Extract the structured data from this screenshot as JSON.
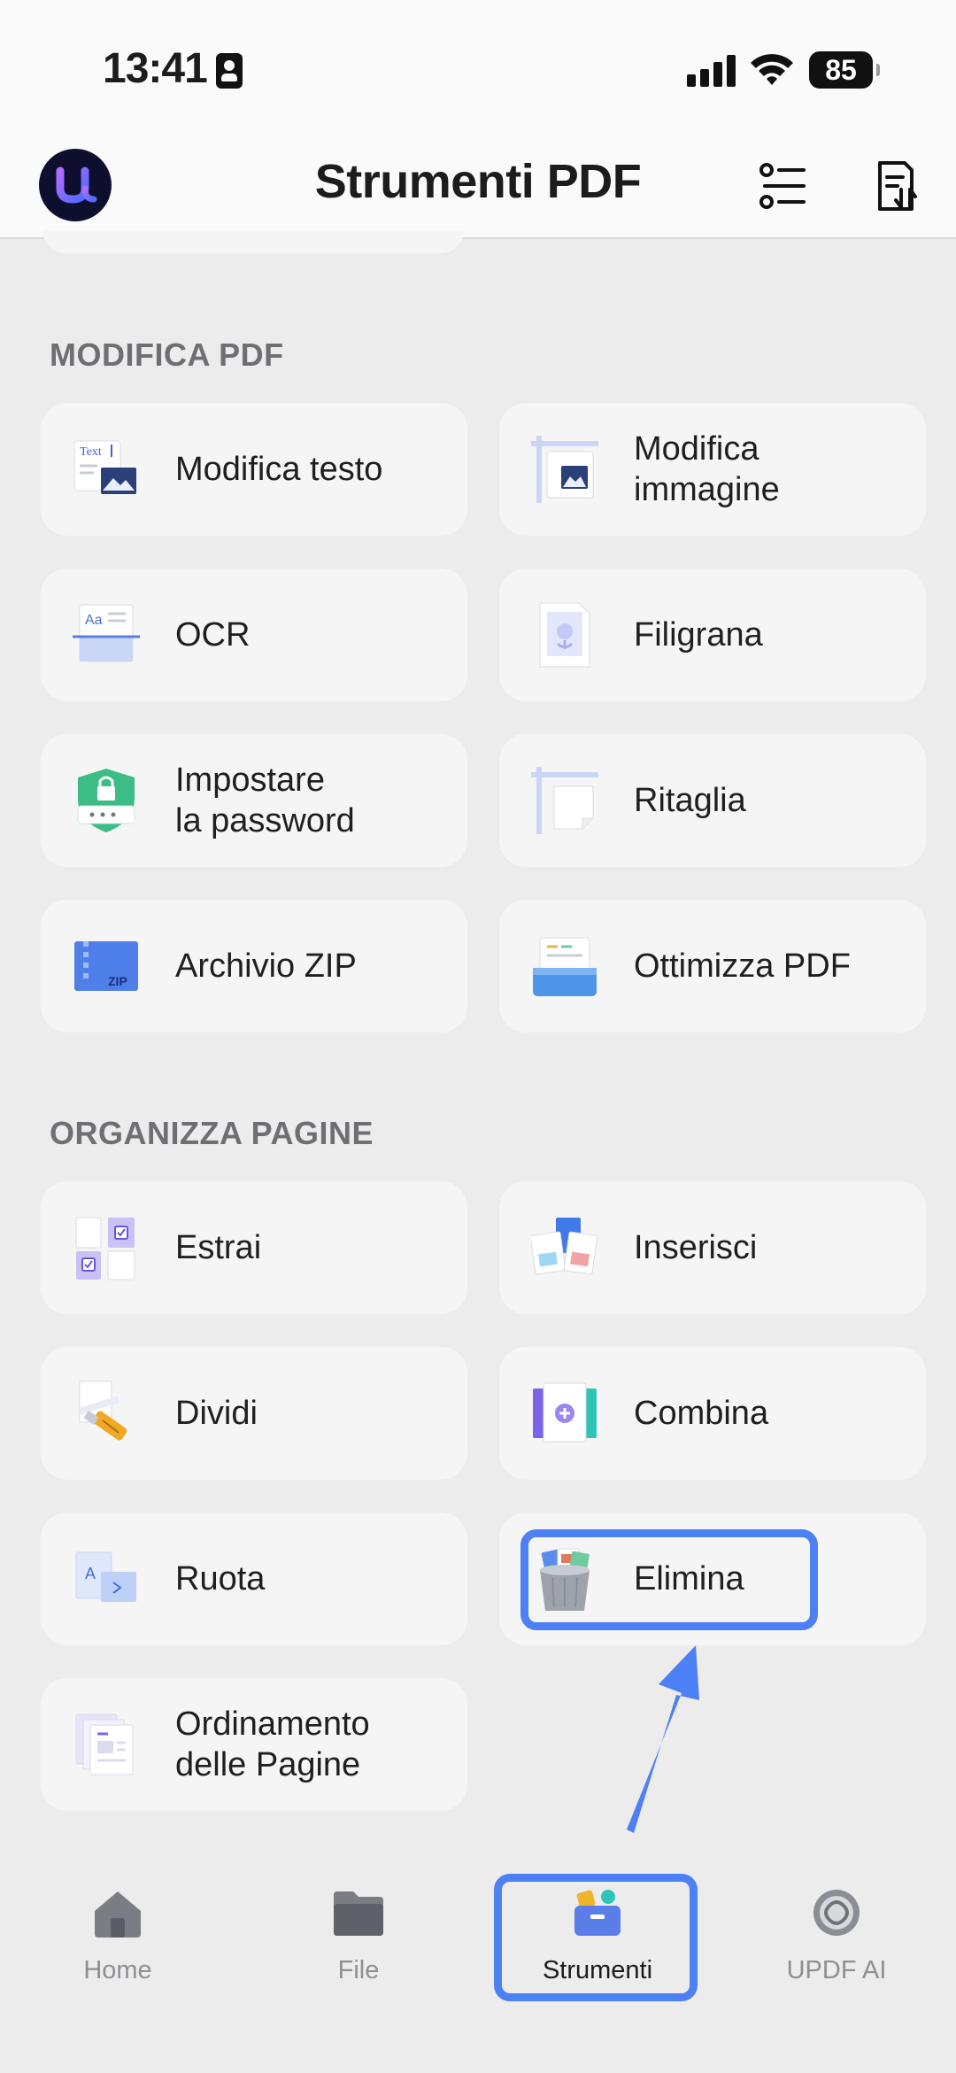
{
  "status_bar": {
    "time": "13:41",
    "battery": "85"
  },
  "header": {
    "title": "Strumenti PDF"
  },
  "sections": {
    "edit": {
      "title": "MODIFICA PDF"
    },
    "organize": {
      "title": "ORGANIZZA PAGINE"
    }
  },
  "tools": {
    "edit_text": "Modifica testo",
    "edit_image": "Modifica\nimmagine",
    "ocr": "OCR",
    "watermark": "Filigrana",
    "password": "Impostare\nla password",
    "crop": "Ritaglia",
    "zip": "Archivio ZIP",
    "optimize": "Ottimizza PDF",
    "extract": "Estrai",
    "insert": "Inserisci",
    "split": "Dividi",
    "combine": "Combina",
    "rotate": "Ruota",
    "delete": "Elimina",
    "reorder": "Ordinamento\ndelle Pagine"
  },
  "icon_text": {
    "text_tag": "Text",
    "ocr_tag": "Aa",
    "zip_tag": "ZIP",
    "rotate_tag": "A"
  },
  "tabbar": {
    "home": "Home",
    "file": "File",
    "tools": "Strumenti",
    "ai": "UPDF AI"
  },
  "colors": {
    "highlight": "#4d7ff5",
    "accent": "#7b5cf5",
    "card": "#f5f5f5",
    "background": "#ececec"
  },
  "icons": [
    "person-badge-icon",
    "signal-icon",
    "wifi-icon",
    "battery-icon",
    "updf-logo",
    "list-icon",
    "sort-document-icon",
    "text-image-icon",
    "ruler-image-icon",
    "ocr-scan-icon",
    "watermark-icon",
    "shield-lock-icon",
    "crop-icon",
    "zip-icon",
    "tray-icon",
    "extract-icon",
    "insert-icon",
    "cutter-icon",
    "combine-icon",
    "rotate-icon",
    "trash-icon",
    "pages-icon",
    "home-icon",
    "folder-icon",
    "toolbox-icon",
    "ai-icon"
  ]
}
